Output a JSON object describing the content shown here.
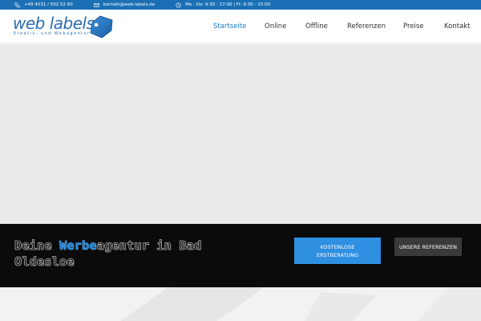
{
  "topbar": {
    "phone": "+49 4531 / 502 52 60",
    "email": "kontakt@web-labels.de",
    "hours": "Mo - Do: 9:30 - 17:00 | Fr: 9:30 - 15:00"
  },
  "logo": {
    "name": "web labels",
    "tagline": "Kreativ- und Webagentur"
  },
  "nav": {
    "items": [
      "Startseite",
      "Online",
      "Offline",
      "Referenzen",
      "Preise",
      "Kontakt"
    ],
    "active_index": 0
  },
  "band": {
    "headline_part1": "Deine ",
    "headline_highlight": "Werbe",
    "headline_part2": "agentur in Bad Oldesloe",
    "primary_button": "Kostenlose Erstberatung",
    "secondary_button": "Unsere Referenzen"
  },
  "colors": {
    "topbar": "#1a6fb5",
    "accent": "#1a7ac8",
    "band": "#0b0b0b",
    "primary_button": "#2f8fe0",
    "secondary_button": "#3a3a3a"
  }
}
